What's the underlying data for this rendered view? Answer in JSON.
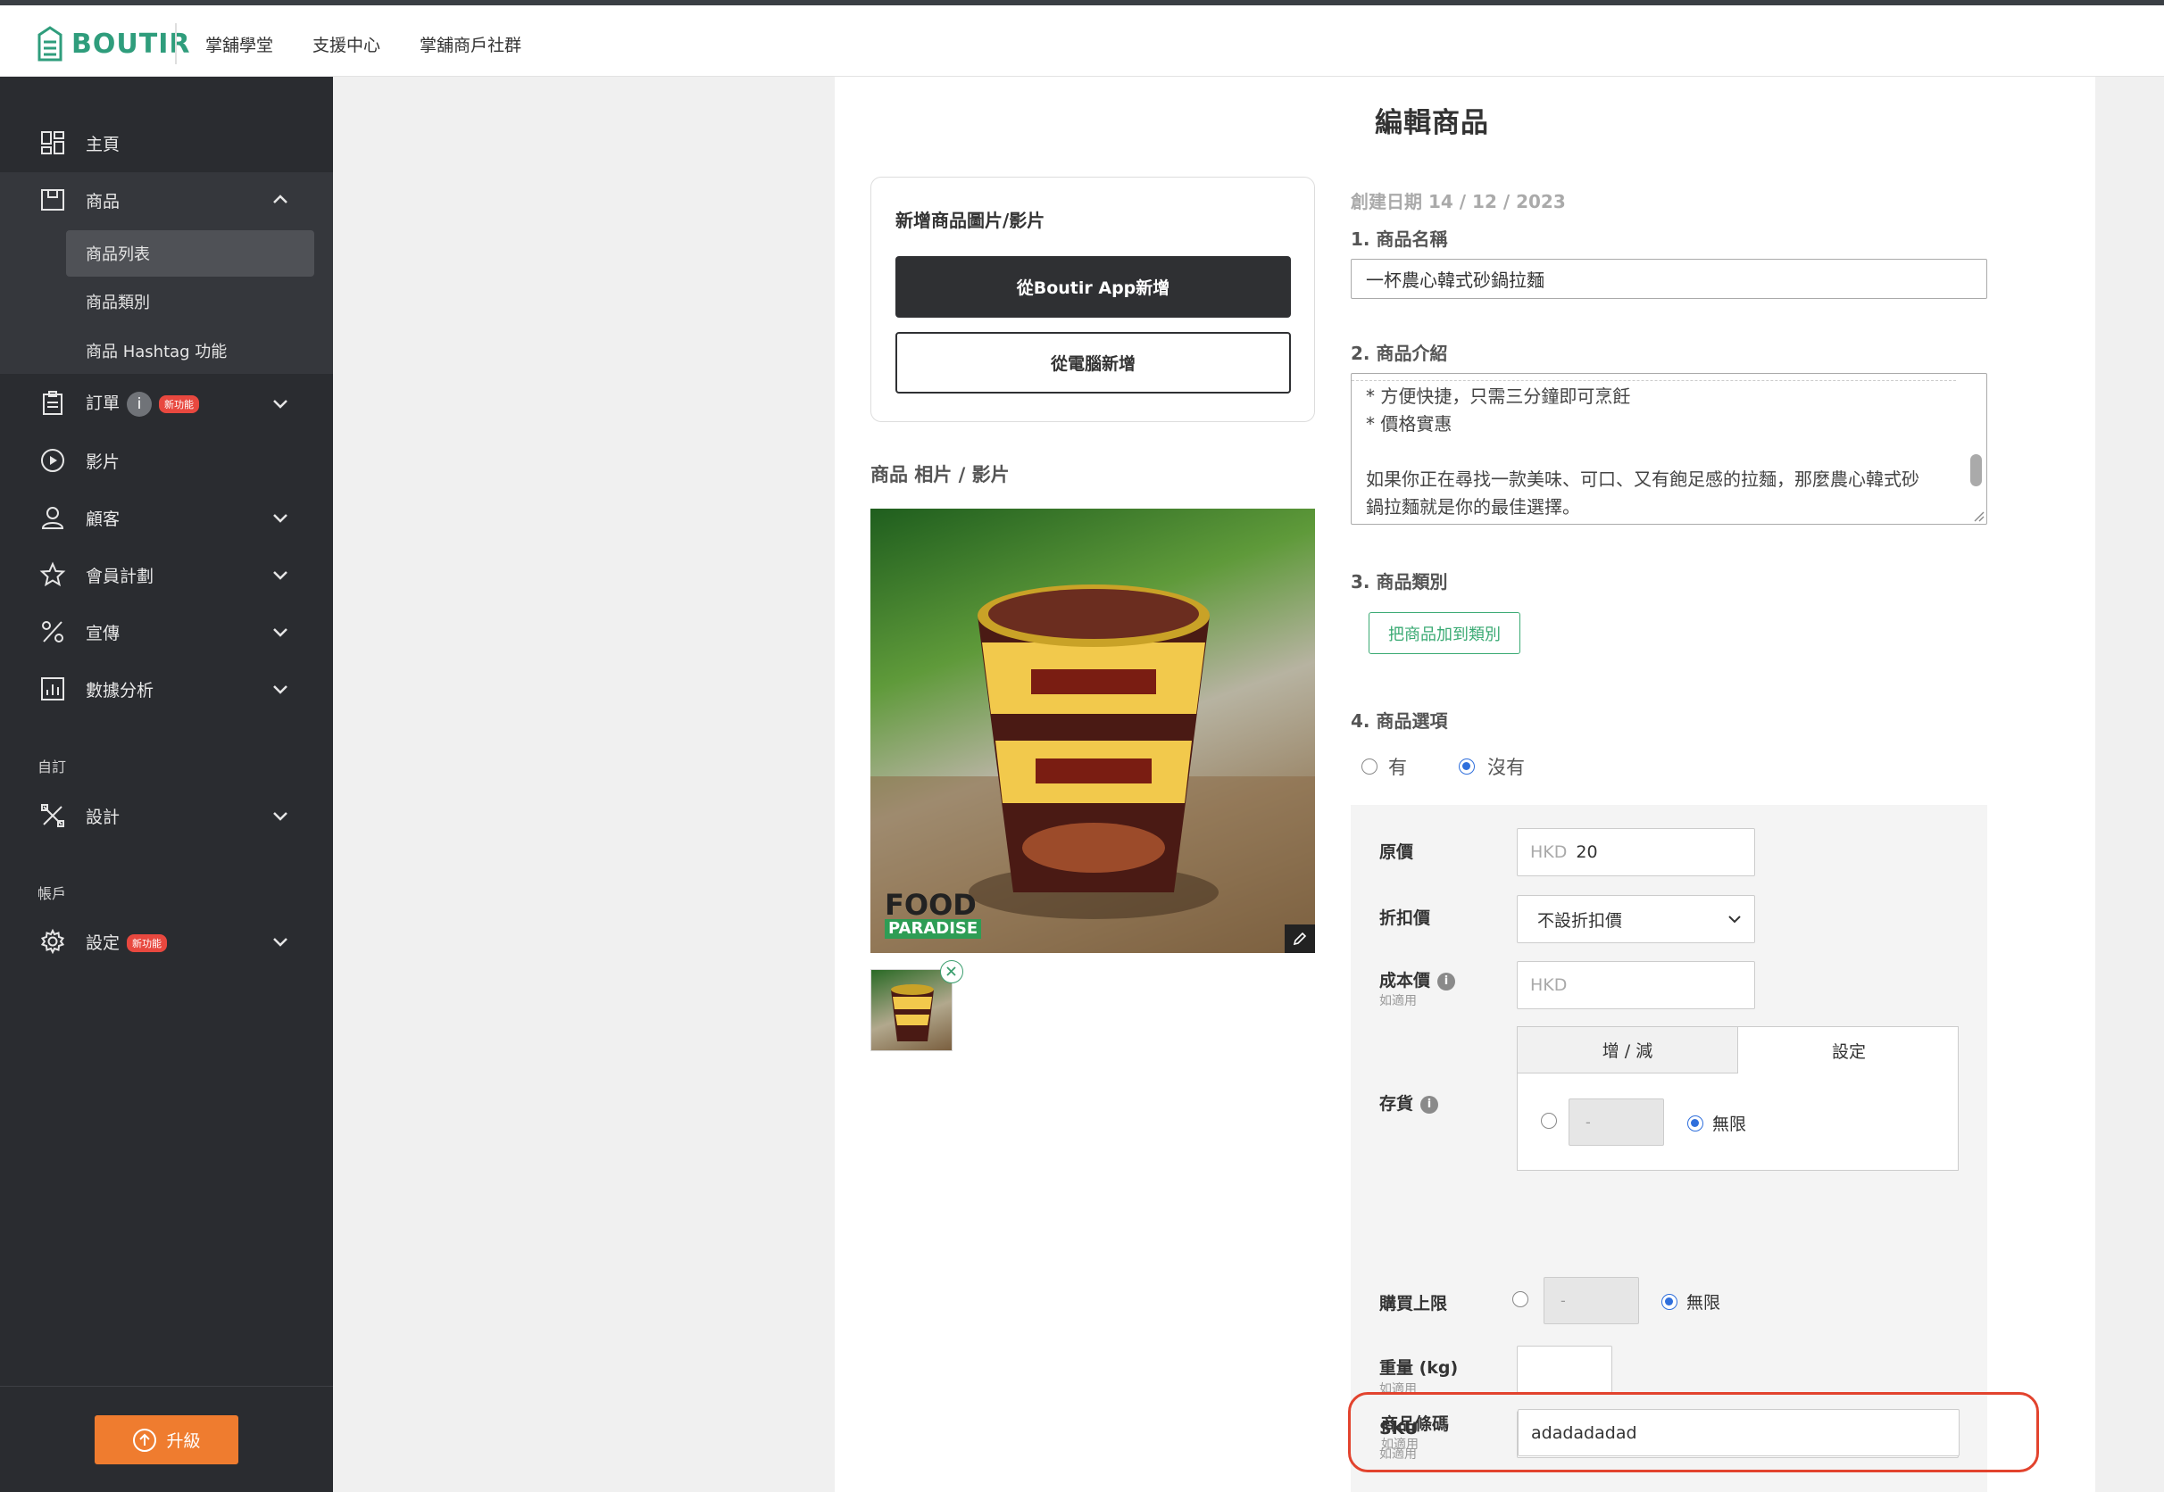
{
  "app": {
    "brand": "BOUTIR",
    "brand_color": "#2f9d7c"
  },
  "topnav": [
    "掌舖學堂",
    "支援中心",
    "掌舖商戶社群"
  ],
  "sidebar": {
    "items": [
      {
        "label": "主頁",
        "icon": "grid-icon"
      },
      {
        "label": "商品",
        "icon": "product-icon",
        "expanded": true
      },
      {
        "label": "訂單",
        "icon": "clipboard-icon",
        "info": "i",
        "badge": "新功能"
      },
      {
        "label": "影片",
        "icon": "play-icon"
      },
      {
        "label": "顧客",
        "icon": "user-icon"
      },
      {
        "label": "會員計劃",
        "icon": "star-icon"
      },
      {
        "label": "宣傳",
        "icon": "percent-icon"
      },
      {
        "label": "數據分析",
        "icon": "chart-icon"
      },
      {
        "label": "設計",
        "icon": "design-icon"
      },
      {
        "label": "設定",
        "icon": "gear-icon",
        "badge": "新功能"
      }
    ],
    "sub_items": [
      "商品列表",
      "商品類別",
      "商品 Hashtag 功能"
    ],
    "sections": [
      "自訂",
      "帳戶"
    ],
    "upgrade_label": "升級"
  },
  "page": {
    "title": "編輯商品",
    "media_card": {
      "title": "新增商品圖片/影片",
      "btn_app": "從Boutir App新增",
      "btn_pc": "從電腦新增"
    },
    "photos_title": "商品 相片 / 影片",
    "photo_watermark": {
      "line1": "FOOD",
      "line2": "PARADISE"
    },
    "created": "創建日期 14 / 12 / 2023",
    "name_label": "1. 商品名稱",
    "name_value": "一杯農心韓式砂鍋拉麵",
    "desc_label": "2. 商品介紹",
    "desc_lines": [
      "* 方便快捷，只需三分鐘即可烹飪",
      "* 價格實惠",
      "",
      "如果你正在尋找一款美味、可口、又有飽足感的拉麵，那麼農心韓式砂",
      "鍋拉麵就是你的最佳選擇。"
    ],
    "category_label": "3. 商品類別",
    "category_btn": "把商品加到類別",
    "options_label": "4. 商品選項",
    "option_yes": "有",
    "option_no": "沒有",
    "option_selected": "沒有",
    "price_label": "原價",
    "price_currency": "HKD",
    "price_value": "20",
    "discount_label": "折扣價",
    "discount_value": "不設折扣價",
    "cost_label": "成本價",
    "cost_sub": "如適用",
    "cost_placeholder": "HKD",
    "stock_label": "存貨",
    "stock_tab_adjust": "增 / 減",
    "stock_tab_set": "設定",
    "stock_input": "-",
    "stock_unlimited": "無限",
    "limit_label": "購買上限",
    "limit_input": "-",
    "limit_unlimited": "無限",
    "weight_label": "重量 (kg)",
    "weight_sub": "如適用",
    "sku_label": "SKU",
    "sku_sub": "如適用",
    "barcode_label": "商品條碼",
    "barcode_sub": "如適用",
    "barcode_value": "adadadadad"
  },
  "colors": {
    "sidebar": "#2a2c30",
    "accent_orange": "#ef7c2f",
    "green": "#3aaa73",
    "highlight": "#e2432e"
  }
}
